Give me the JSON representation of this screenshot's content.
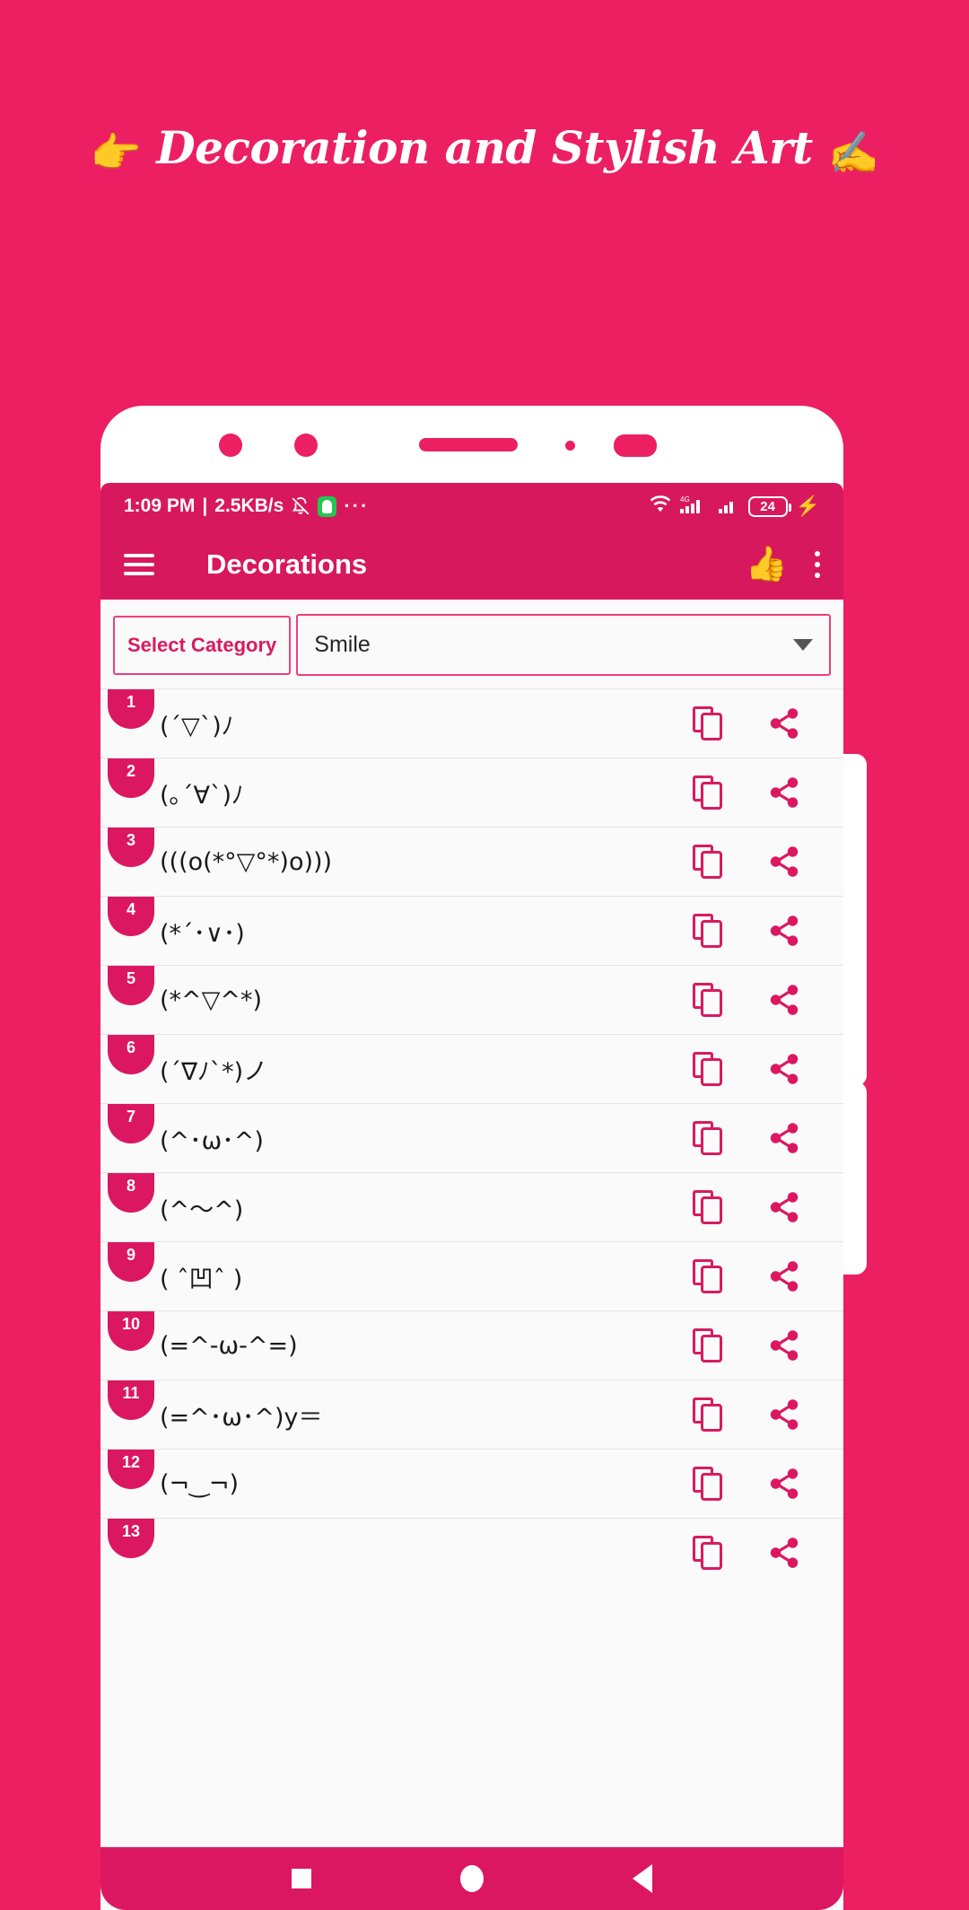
{
  "promo": {
    "left_emoji": "👉",
    "title": "Decoration and Stylish Art",
    "right_emoji": "✍️"
  },
  "colors": {
    "background": "#ec1f63",
    "appbar": "#d8185c",
    "accent": "#dc1761",
    "badge": "#dc1761",
    "screen": "#fafafa"
  },
  "status_bar": {
    "time": "1:09 PM",
    "separator": "|",
    "network_speed": "2.5KB/s",
    "bell_off_icon": "bell-off-icon",
    "android_icon": "android-icon",
    "more_icon": "···",
    "wifi_icon": "wifi-icon",
    "signal_4g_label": "4G",
    "battery_level": "24",
    "charging_icon": "⚡"
  },
  "appbar": {
    "menu_icon": "hamburger-menu-icon",
    "title": "Decorations",
    "like_icon": "👍",
    "overflow_icon": "kebab-menu-icon"
  },
  "category": {
    "label": "Select Category",
    "selected": "Smile",
    "chevron_icon": "chevron-down-icon"
  },
  "list": {
    "copy_icon": "copy-icon",
    "share_icon": "share-icon",
    "rows": [
      {
        "index": "1",
        "text": "(´▽`)ﾉ"
      },
      {
        "index": "2",
        "text": "(｡´∀`)ﾉ"
      },
      {
        "index": "3",
        "text": "(((o(*°▽°*)o)))"
      },
      {
        "index": "4",
        "text": "(*´･∨･)"
      },
      {
        "index": "5",
        "text": "(*^▽^*)"
      },
      {
        "index": "6",
        "text": "(´∇ﾉ`*)ノ"
      },
      {
        "index": "7",
        "text": "(^･ω･^)"
      },
      {
        "index": "8",
        "text": "(^〜^)"
      },
      {
        "index": "9",
        "text": "( ˆ凹ˆ )"
      },
      {
        "index": "10",
        "text": "(=^-ω-^=)"
      },
      {
        "index": "11",
        "text": "(=^･ω･^)y＝"
      },
      {
        "index": "12",
        "text": "(¬‿¬)"
      },
      {
        "index": "13",
        "text": ""
      }
    ]
  },
  "navbar": {
    "recents_icon": "square-recents-icon",
    "home_icon": "circle-home-icon",
    "back_icon": "triangle-back-icon"
  }
}
